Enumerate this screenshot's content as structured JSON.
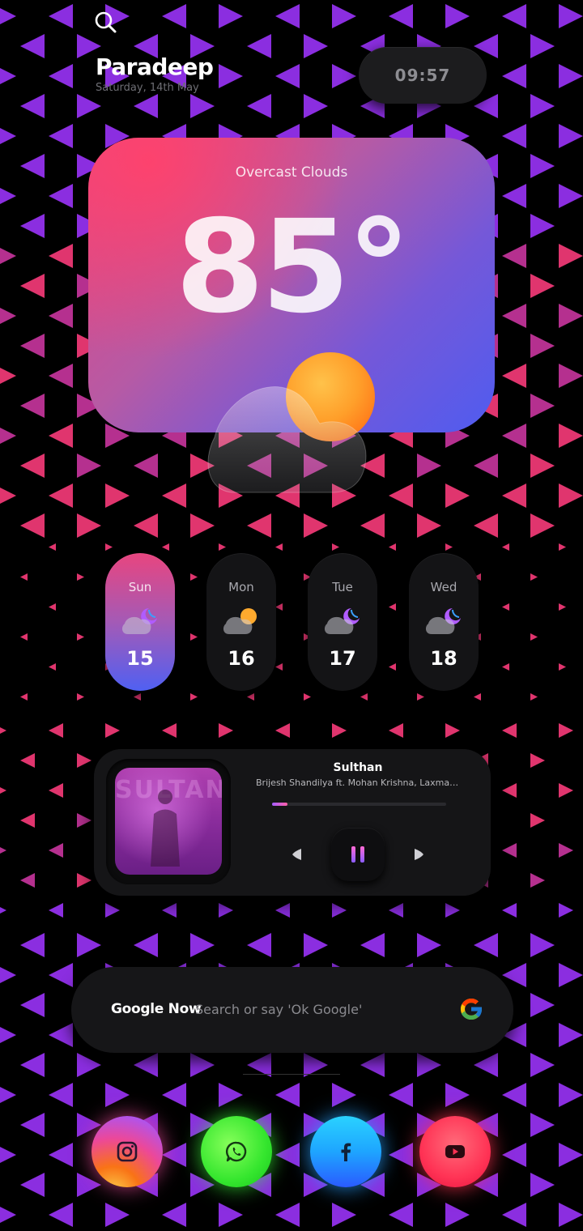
{
  "header": {
    "search_icon": "search-icon",
    "city": "Paradeep",
    "date": "Saturday, 14th May",
    "time": "09:57"
  },
  "weather": {
    "condition": "Overcast Clouds",
    "temperature": "85°",
    "icon": "cloud-sun-icon"
  },
  "forecast": [
    {
      "day": "Sun",
      "date": "15",
      "icon": "cloud-moon-icon",
      "active": true
    },
    {
      "day": "Mon",
      "date": "16",
      "icon": "cloud-sun-icon",
      "active": false
    },
    {
      "day": "Tue",
      "date": "17",
      "icon": "cloud-moon-icon",
      "active": false
    },
    {
      "day": "Wed",
      "date": "18",
      "icon": "cloud-moon-icon",
      "active": false
    }
  ],
  "music": {
    "title": "Sulthan",
    "artist": "Brijesh Shandilya ft. Mohan Krishna, Laxman Datt...",
    "album_text": "SULTAN",
    "progress": 0.09,
    "prev_icon": "prev-icon",
    "pause_icon": "pause-icon",
    "next_icon": "next-icon"
  },
  "search": {
    "brand": "Google Now",
    "hint": "Search or say 'Ok Google'",
    "logo": "google-logo-icon"
  },
  "dock": [
    {
      "name": "instagram",
      "icon": "instagram-icon"
    },
    {
      "name": "whatsapp",
      "icon": "whatsapp-icon"
    },
    {
      "name": "facebook",
      "icon": "facebook-icon"
    },
    {
      "name": "youtube",
      "icon": "youtube-icon"
    }
  ],
  "colors": {
    "background": "#000000",
    "triangle_purple": "#8b2ee0",
    "triangle_pink": "#e0356e",
    "accent_pink": "#e8457f",
    "accent_blue": "#4f5cf0"
  }
}
